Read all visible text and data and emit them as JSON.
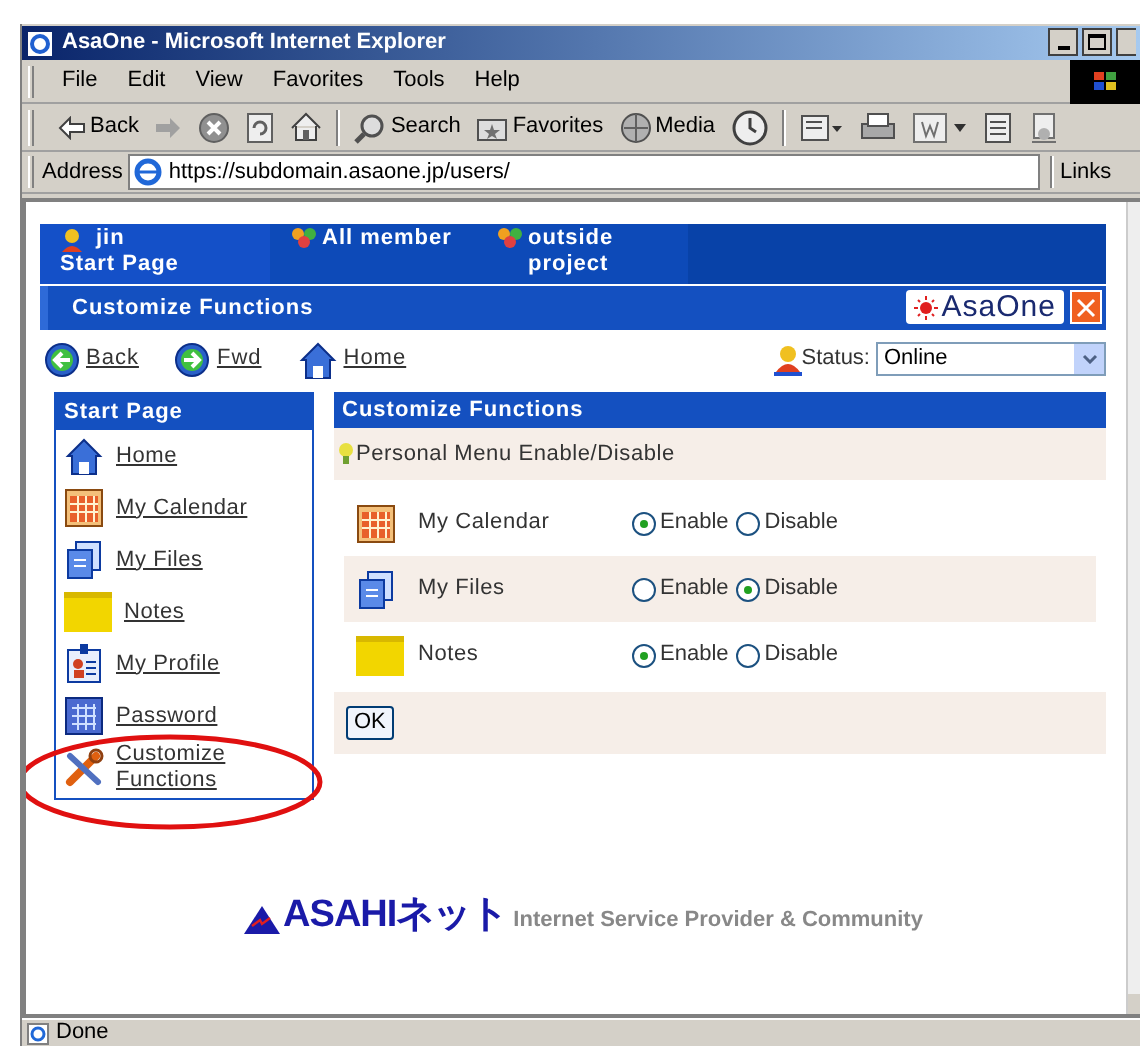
{
  "window": {
    "title": "AsaOne - Microsoft Internet Explorer"
  },
  "menu": [
    "File",
    "Edit",
    "View",
    "Favorites",
    "Tools",
    "Help"
  ],
  "toolbar": [
    {
      "kind": "back",
      "label": "Back"
    },
    {
      "kind": "forward"
    },
    {
      "kind": "stop"
    },
    {
      "kind": "refresh"
    },
    {
      "kind": "home"
    },
    {
      "kind": "search",
      "label": "Search"
    },
    {
      "kind": "favorites",
      "label": "Favorites"
    },
    {
      "kind": "media",
      "label": "Media"
    },
    {
      "kind": "history"
    },
    {
      "kind": "mail"
    },
    {
      "kind": "print"
    },
    {
      "kind": "edit"
    },
    {
      "kind": "discuss"
    },
    {
      "kind": "messenger"
    }
  ],
  "address_bar": {
    "label": "Address",
    "url": "https://subdomain.asaone.jp/users/",
    "links": "Links"
  },
  "page": {
    "tabs": [
      {
        "kind": "user",
        "user": "jin",
        "label": "Start Page",
        "selected": true
      },
      {
        "kind": "group",
        "label": "All member",
        "selected": false
      },
      {
        "kind": "group",
        "label": "outside project",
        "selected": false
      }
    ],
    "title_bar": {
      "title": "Customize Functions",
      "logo": "AsaOne"
    },
    "nav": [
      {
        "kind": "back",
        "label": "Back"
      },
      {
        "kind": "forward",
        "label": "Fwd"
      },
      {
        "kind": "home",
        "label": "Home"
      }
    ],
    "status": {
      "label": "Status:",
      "value": "Online"
    },
    "sidebar": {
      "title": "Start Page",
      "items": [
        {
          "kind": "home",
          "label": "Home"
        },
        {
          "kind": "calendar",
          "label": "My Calendar"
        },
        {
          "kind": "files",
          "label": "My Files"
        },
        {
          "kind": "notes",
          "label": "Notes"
        },
        {
          "kind": "profile",
          "label": "My Profile"
        },
        {
          "kind": "password",
          "label": "Password"
        },
        {
          "kind": "tools",
          "label": "Customize Functions"
        }
      ]
    },
    "panel": {
      "title": "Customize Functions",
      "subtitle": "Personal Menu Enable/Disable",
      "rows": [
        {
          "kind": "calendar",
          "label": "My Calendar",
          "options": [
            {
              "label": "Enable",
              "selected": true
            },
            {
              "label": "Disable",
              "selected": false
            }
          ]
        },
        {
          "kind": "files",
          "label": "My Files",
          "options": [
            {
              "label": "Enable",
              "selected": false
            },
            {
              "label": "Disable",
              "selected": true
            }
          ]
        },
        {
          "kind": "notes",
          "label": "Notes",
          "options": [
            {
              "label": "Enable",
              "selected": true
            },
            {
              "label": "Disable",
              "selected": false
            }
          ]
        }
      ],
      "ok": "OK"
    },
    "footer": {
      "logo": "ASAHIネット",
      "tagline": "Internet Service Provider & Community"
    }
  },
  "status_bar": {
    "text": "Done"
  }
}
